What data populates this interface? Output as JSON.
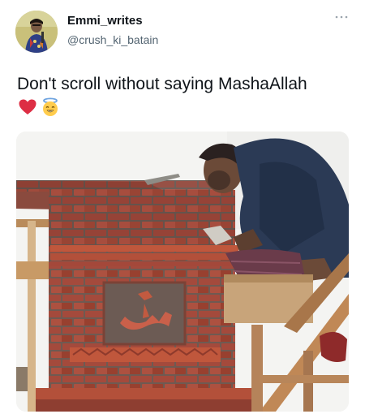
{
  "tweet": {
    "display_name": "Emmi_writes",
    "handle": "@crush_ki_batain",
    "text": "Don't scroll without saying MashaAllah",
    "emojis": [
      "red-heart-emoji",
      "smiling-face-with-halo-emoji"
    ]
  },
  "icons": {
    "more": "more-horizontal-icon",
    "avatar": "profile-avatar"
  },
  "colors": {
    "text_primary": "#0f1419",
    "text_secondary": "#536471",
    "brick": "#a0453a",
    "ornament": "#c0573c"
  }
}
